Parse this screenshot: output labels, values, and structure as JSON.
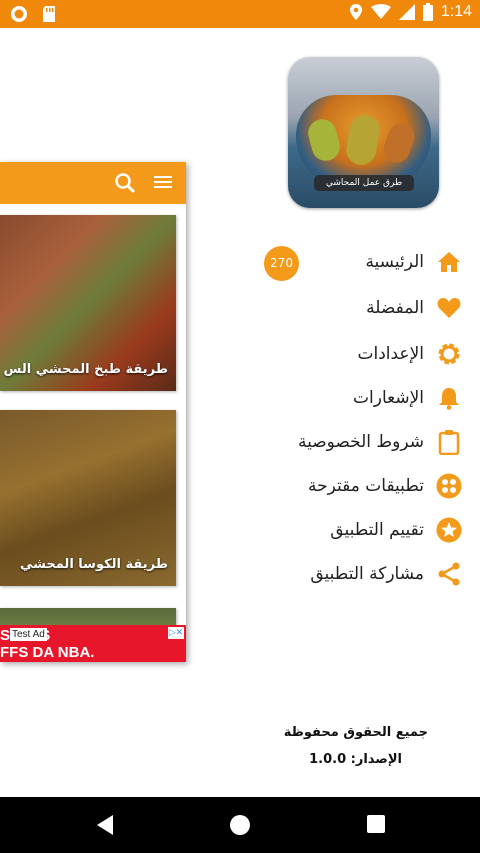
{
  "status_bar": {
    "time": "1:14"
  },
  "app": {
    "accent_color": "#f39a1a",
    "logo_caption": "طرق عمل المحاشي"
  },
  "drawer": {
    "items": [
      {
        "label": "الرئيسية",
        "icon": "home-icon"
      },
      {
        "label": "المفضلة",
        "icon": "heart-icon"
      },
      {
        "label": "الإعدادات",
        "icon": "gear-icon"
      },
      {
        "label": "الإشعارات",
        "icon": "bell-icon"
      },
      {
        "label": "شروط الخصوصية",
        "icon": "clipboard-icon"
      },
      {
        "label": "تطبيقات مقترحة",
        "icon": "apps-grid-icon"
      },
      {
        "label": "تقييم التطبيق",
        "icon": "star-icon"
      },
      {
        "label": "مشاركة التطبيق",
        "icon": "share-icon"
      }
    ],
    "home_badge": "270",
    "rights": "جميع الحقوق محفوظة",
    "version": "الإصدار: 1.0.0"
  },
  "background": {
    "cards": [
      {
        "title": "طريقة طبخ المحشي الس"
      },
      {
        "title": "طريقة الكوسا المحشي"
      }
    ],
    "ad": {
      "tag": "Test Ad",
      "line1": "SI AOS",
      "line2": "FFS DA NBA."
    }
  }
}
